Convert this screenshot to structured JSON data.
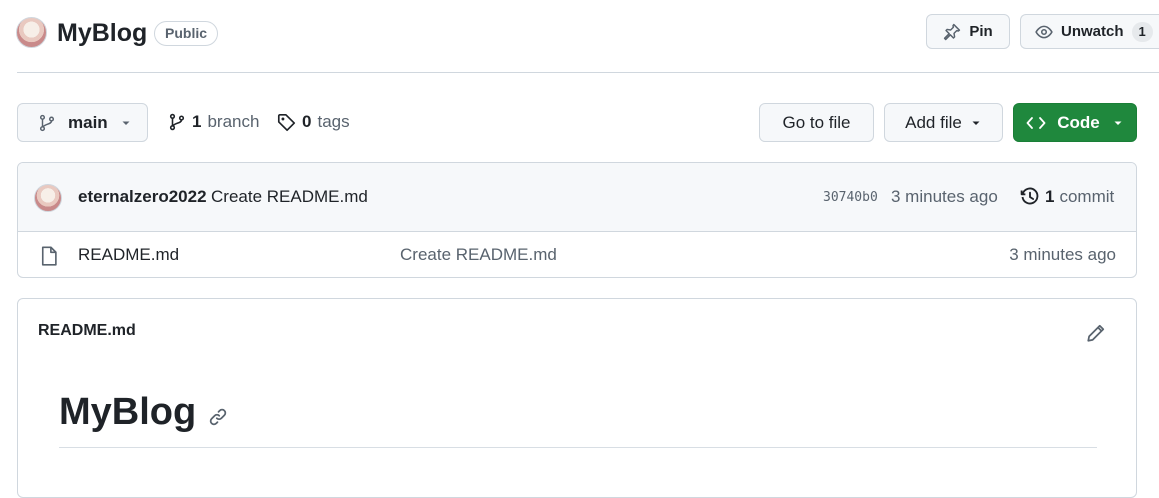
{
  "repo": {
    "name": "MyBlog",
    "visibility": "Public"
  },
  "actions": {
    "pin_label": "Pin",
    "unwatch_label": "Unwatch",
    "watch_count": "1"
  },
  "toolbar": {
    "branch_name": "main",
    "branches_count": "1",
    "branches_label": "branch",
    "tags_count": "0",
    "tags_label": "tags",
    "goto_file": "Go to file",
    "add_file": "Add file",
    "code": "Code"
  },
  "latest_commit": {
    "author": "eternalzero2022",
    "message": "Create README.md",
    "sha": "30740b0",
    "time": "3 minutes ago",
    "count": "1",
    "count_label": "commit"
  },
  "files": [
    {
      "name": "README.md",
      "message": "Create README.md",
      "time": "3 minutes ago"
    }
  ],
  "readme": {
    "filename": "README.md",
    "heading": "MyBlog"
  },
  "colors": {
    "primary_button": "#1f883d",
    "border": "#d0d7de",
    "muted_text": "#59636e"
  }
}
